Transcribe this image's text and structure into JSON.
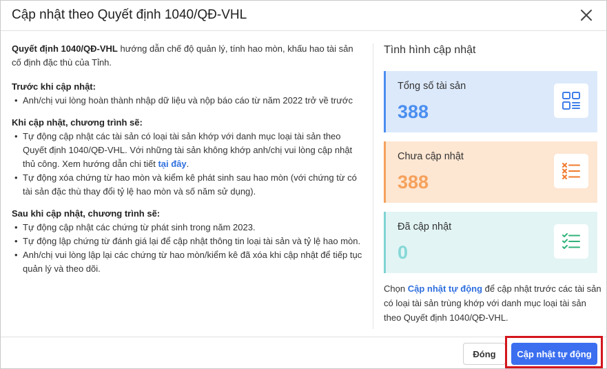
{
  "dialog": {
    "title": "Cập nhật theo Quyết định 1040/QĐ-VHL"
  },
  "intro": {
    "bold": "Quyết định 1040/QĐ-VHL",
    "text": " hướng dẫn chế độ quản lý, tính hao mòn, khấu hao tài sản cố định đặc thù của Tỉnh."
  },
  "before": {
    "heading": "Trước khi cập nhật:",
    "items": [
      "Anh/chị vui lòng hoàn thành nhập dữ liệu và nộp báo cáo từ năm 2022 trở về trước"
    ]
  },
  "during": {
    "heading": "Khi cập nhật, chương trình sẽ:",
    "item1_text": "Tự động cập nhật các tài sản có loại tài sản khớp với danh mục loại tài sản theo Quyết định 1040/QĐ-VHL. Với những tài sản không khớp anh/chị vui lòng cập nhật thủ công. Xem hướng dẫn chi tiết ",
    "item1_link": "tại đây",
    "item1_end": ".",
    "item2_text": "Tự động xóa chứng từ hao mòn và kiểm kê phát sinh sau hao mòn (với chứng từ có tài sản đặc thù thay đổi tỷ lệ hao mòn và số năm sử dụng)."
  },
  "after": {
    "heading": "Sau khi cập nhật, chương trình sẽ:",
    "items": [
      "Tự động cập nhật các chứng từ phát sinh trong năm 2023.",
      "Tự động lập chứng từ đánh giá lại để cập nhật thông tin loại tài sản và tỷ lệ hao mòn.",
      "Anh/chị vui lòng lập lại các chứng từ hao mòn/kiểm kê đã xóa khi cập nhật để tiếp tục quản lý và theo dõi."
    ]
  },
  "status": {
    "title": "Tình hình cập nhật",
    "cards": [
      {
        "label": "Tổng số tài sản",
        "value": "388",
        "icon": "grid-list-icon",
        "color": "#4a8ef0"
      },
      {
        "label": "Chưa cập nhật",
        "value": "388",
        "icon": "x-list-icon",
        "color": "#f5a15c"
      },
      {
        "label": "Đã cập nhật",
        "value": "0",
        "icon": "check-list-icon",
        "color": "#86d8d8"
      }
    ]
  },
  "note": {
    "prefix": "Chọn ",
    "highlight": "Cập nhật tự động",
    "suffix": " để cập nhật trước các tài sản có loại tài sản trùng khớp với danh mục loại tài sản theo Quyết định 1040/QĐ-VHL."
  },
  "footer": {
    "close_label": "Đóng",
    "auto_update_label": "Cập nhật tự động",
    "primary_color": "#3b6ff0",
    "highlight_color": "#d3151c"
  }
}
